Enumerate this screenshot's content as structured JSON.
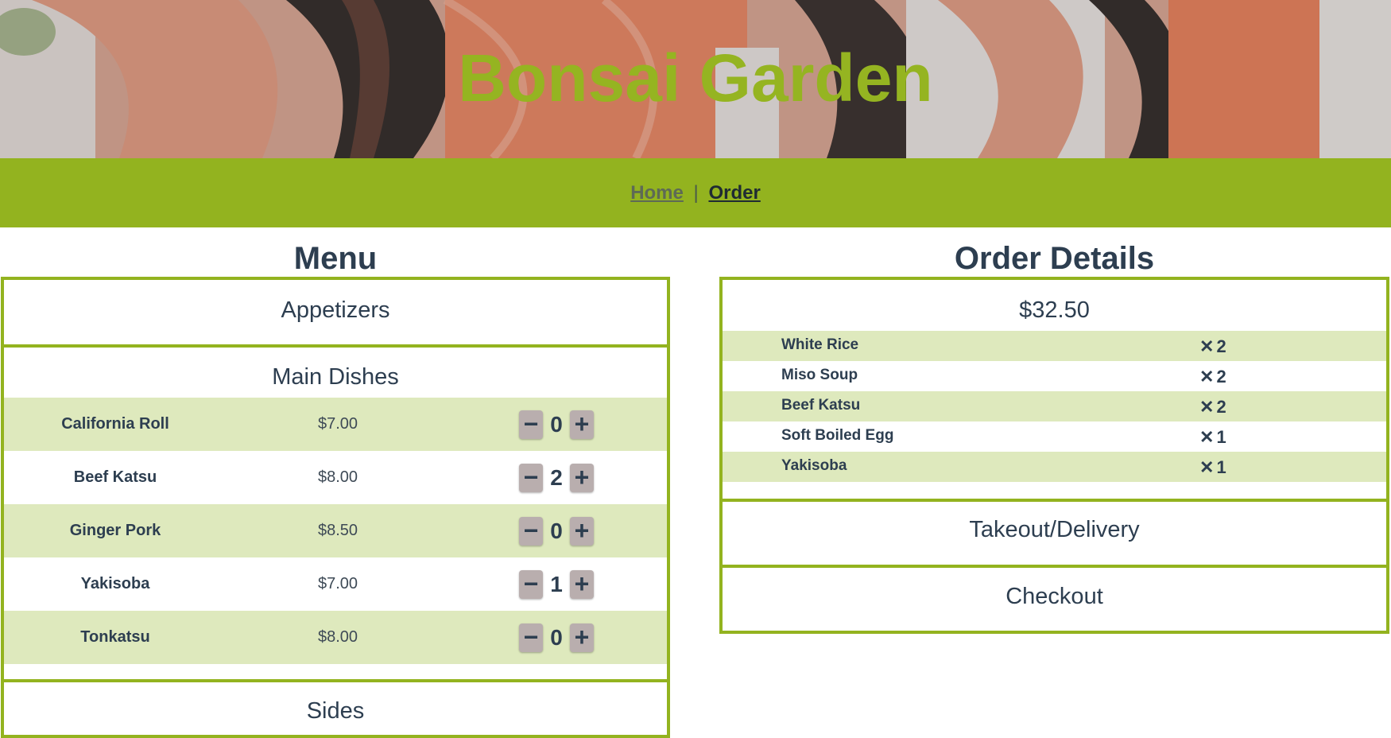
{
  "hero": {
    "title": "Bonsai Garden"
  },
  "nav": {
    "home": "Home",
    "separator": "|",
    "order": "Order"
  },
  "menu": {
    "title": "Menu",
    "sections": {
      "appetizers": "Appetizers",
      "main": "Main Dishes",
      "sides": "Sides"
    },
    "items": [
      {
        "name": "California Roll",
        "price": "$7.00",
        "qty": "0"
      },
      {
        "name": "Beef Katsu",
        "price": "$8.00",
        "qty": "2"
      },
      {
        "name": "Ginger Pork",
        "price": "$8.50",
        "qty": "0"
      },
      {
        "name": "Yakisoba",
        "price": "$7.00",
        "qty": "1"
      },
      {
        "name": "Tonkatsu",
        "price": "$8.00",
        "qty": "0"
      }
    ],
    "minus_glyph": "−",
    "plus_glyph": "+"
  },
  "order": {
    "title": "Order Details",
    "total": "$32.50",
    "times_glyph": "✕",
    "items": [
      {
        "name": "White Rice",
        "qty": "2"
      },
      {
        "name": "Miso Soup",
        "qty": "2"
      },
      {
        "name": "Beef Katsu",
        "qty": "2"
      },
      {
        "name": "Soft Boiled Egg",
        "qty": "1"
      },
      {
        "name": "Yakisoba",
        "qty": "1"
      }
    ],
    "takeout": "Takeout/Delivery",
    "checkout": "Checkout"
  },
  "colors": {
    "accent": "#93b31f",
    "title_green": "#95b421",
    "row_alt": "#dee9bd",
    "text": "#2d3e50",
    "stepper": "#b9aeae"
  }
}
